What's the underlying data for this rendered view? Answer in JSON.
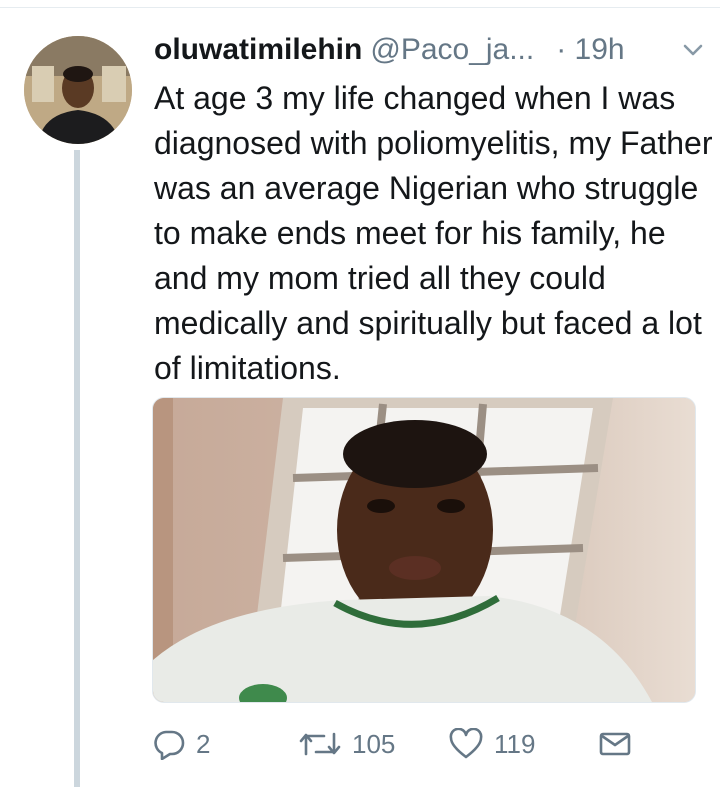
{
  "tweet": {
    "display_name": "oluwatimilehin",
    "handle": "@Paco_ja...",
    "time": "· 19h",
    "text": "At age 3 my life changed when I was diagnosed with poliomyelitis, my Father was an average Nigerian who struggle to make ends meet for his family, he and my mom tried all they could medically and spiritually but faced a lot of limitations."
  },
  "actions": {
    "reply_count": "2",
    "retweet_count": "105",
    "like_count": "119"
  },
  "icons": {
    "reply": "reply-icon",
    "retweet": "retweet-icon",
    "like": "heart-icon",
    "dm": "envelope-icon",
    "menu": "chevron-down-icon"
  },
  "colors": {
    "text": "#14171a",
    "secondary": "#657786",
    "thread_line": "#ccd6dd"
  }
}
